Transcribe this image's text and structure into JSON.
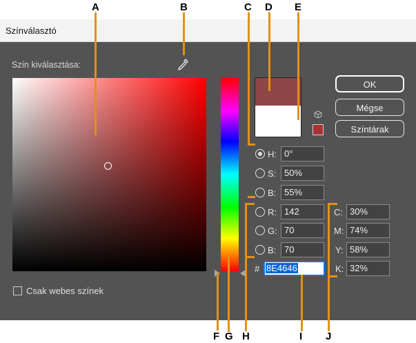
{
  "window": {
    "title": "Színválasztó"
  },
  "picker": {
    "section_label": "Szín kiválasztása:"
  },
  "colors": {
    "current": "#8E4646",
    "previous": "#FFFFFF",
    "gamut_warning": "#A83232",
    "callout_line": "#E3901A"
  },
  "buttons": {
    "ok": "OK",
    "cancel": "Mégse",
    "swatches": "Színtárak"
  },
  "hsb": [
    {
      "label": "H:",
      "value": "0°",
      "checked": true
    },
    {
      "label": "S:",
      "value": "50%",
      "checked": false
    },
    {
      "label": "B:",
      "value": "55%",
      "checked": false
    }
  ],
  "rgb": [
    {
      "label": "R:",
      "value": "142"
    },
    {
      "label": "G:",
      "value": "70"
    },
    {
      "label": "B:",
      "value": "70"
    }
  ],
  "hex": {
    "prefix": "#",
    "value": "8E4646"
  },
  "cmyk": [
    {
      "label": "C:",
      "value": "30%"
    },
    {
      "label": "M:",
      "value": "74%"
    },
    {
      "label": "Y:",
      "value": "58%"
    },
    {
      "label": "K:",
      "value": "32%"
    }
  ],
  "web_only": {
    "label": "Csak webes színek",
    "checked": false
  },
  "annotations": [
    "A",
    "B",
    "C",
    "D",
    "E",
    "F",
    "G",
    "H",
    "I",
    "J"
  ],
  "icons": {
    "eyedropper": "eyedropper-icon",
    "cube": "cube-icon"
  }
}
